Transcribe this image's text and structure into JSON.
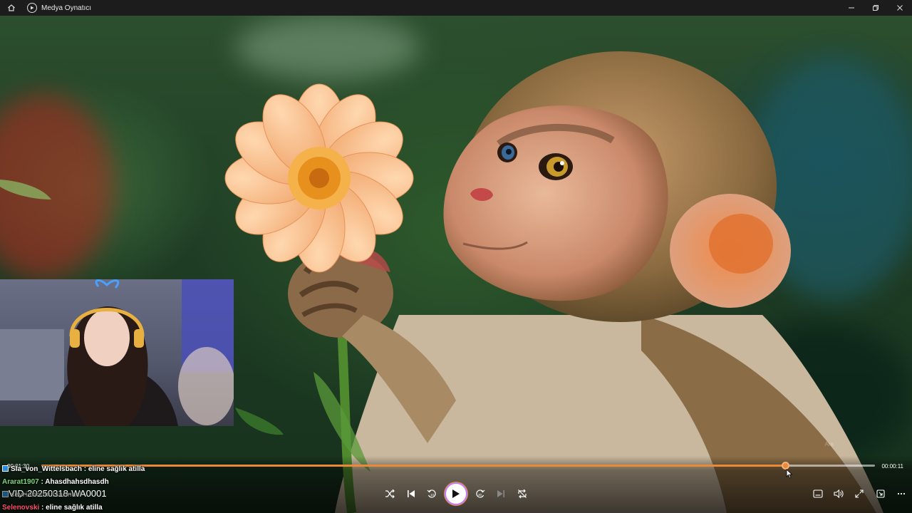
{
  "window": {
    "title": "Medya Oynatıcı"
  },
  "player": {
    "media_title": "VID-20250318-WA0001",
    "time_elapsed": "00:01:30",
    "time_remaining": "00:00:11",
    "progress_fraction": 0.892,
    "watermark": "Ara"
  },
  "chat": [
    {
      "user": "Sla_von_Wittelsbach",
      "separator": " : ",
      "message": "eline sağlık atilla",
      "user_color": "#ffffff",
      "badge": true
    },
    {
      "user": "Ararat1907",
      "separator": " : ",
      "message": "Ahasdhahsdhasdh",
      "user_color": "#7fd67f",
      "badge": false
    },
    {
      "user": "seyrioncukulsarmael",
      "separator": "",
      "message": "",
      "user_color": "#bbbbbb",
      "badge": true
    },
    {
      "user": "Selenovski",
      "separator": " : ",
      "message": "eline sağlık atilla",
      "user_color": "#ff4d6a",
      "badge": false
    }
  ],
  "colors": {
    "accent": "#e88a3a",
    "play_ring": "#c07bff",
    "titlebar": "#1c1c1c"
  },
  "icons": [
    "home-icon",
    "media-player-icon",
    "minimize-icon",
    "restore-icon",
    "close-icon",
    "shuffle-icon",
    "previous-icon",
    "rewind-10-icon",
    "play-icon",
    "forward-30-icon",
    "next-icon",
    "repeat-off-icon",
    "subtitles-icon",
    "volume-icon",
    "fullscreen-icon",
    "mini-player-icon",
    "more-icon"
  ]
}
